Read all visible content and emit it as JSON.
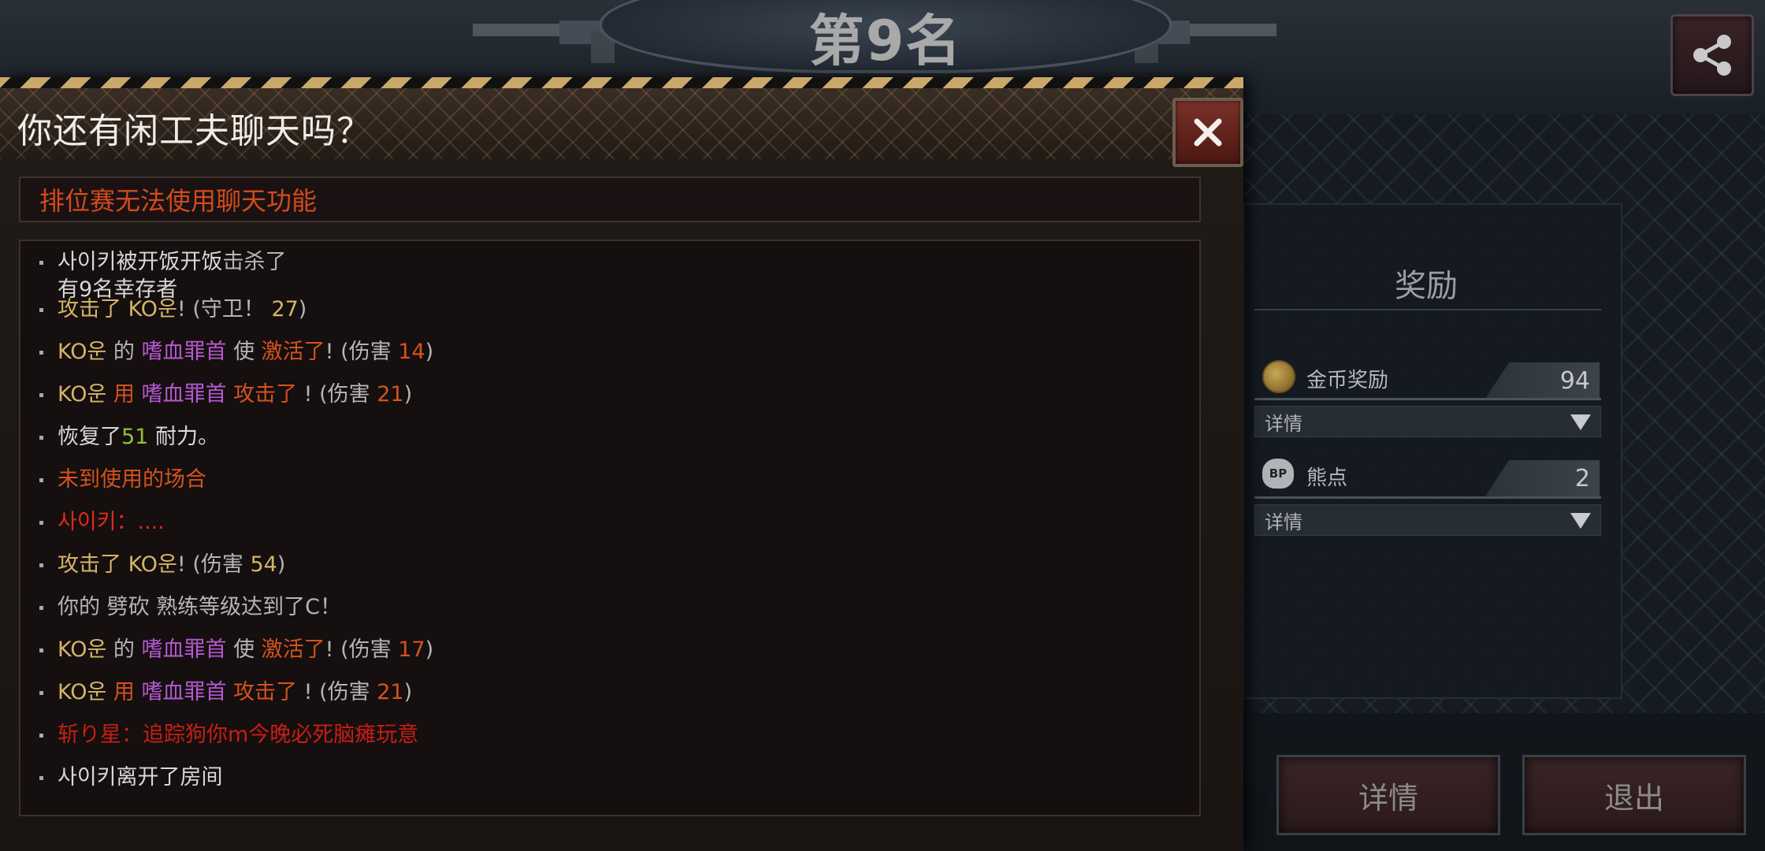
{
  "game": {
    "rank_title": "第9名"
  },
  "chat_modal": {
    "title": "你还有闲工夫聊天吗？",
    "notice": "排位赛无法使用聊天功能",
    "lines": [
      {
        "parts": [
          {
            "t": "사이키",
            "c": "white"
          },
          {
            "t": "被开饭开饭",
            "c": "white"
          },
          {
            "t": "击杀了",
            "c": "gray"
          }
        ],
        "second": "有9名幸存者"
      },
      {
        "parts": [
          {
            "t": "攻击了 KO운",
            "c": "gold"
          },
          {
            "t": "! (守卫！ ",
            "c": "gray"
          },
          {
            "t": "27",
            "c": "gold"
          },
          {
            "t": ")",
            "c": "gray"
          }
        ]
      },
      {
        "parts": [
          {
            "t": "KO운",
            "c": "gold"
          },
          {
            "t": " 的 ",
            "c": "gray"
          },
          {
            "t": "嗜血罪首",
            "c": "purple"
          },
          {
            "t": " 使 ",
            "c": "gray"
          },
          {
            "t": " 激活了",
            "c": "orange"
          },
          {
            "t": "! (伤害 ",
            "c": "gray"
          },
          {
            "t": "14",
            "c": "orange"
          },
          {
            "t": ")",
            "c": "gray"
          }
        ]
      },
      {
        "parts": [
          {
            "t": "KO운",
            "c": "gold"
          },
          {
            "t": "  用 ",
            "c": "orange"
          },
          {
            "t": "嗜血罪首",
            "c": "purple"
          },
          {
            "t": " 攻击了 ",
            "c": "orange"
          },
          {
            "t": " ! (伤害 ",
            "c": "gray"
          },
          {
            "t": "21",
            "c": "orange"
          },
          {
            "t": ")",
            "c": "gray"
          }
        ]
      },
      {
        "parts": [
          {
            "t": "恢复了",
            "c": "white"
          },
          {
            "t": "51",
            "c": "green"
          },
          {
            "t": " 耐力。",
            "c": "white"
          }
        ]
      },
      {
        "parts": [
          {
            "t": "未到使用的场合",
            "c": "orange"
          }
        ]
      },
      {
        "parts": [
          {
            "t": "사이키：....",
            "c": "red"
          }
        ]
      },
      {
        "parts": [
          {
            "t": "攻击了 KO운",
            "c": "gold"
          },
          {
            "t": "! (伤害 ",
            "c": "gray"
          },
          {
            "t": "54",
            "c": "gold"
          },
          {
            "t": ")",
            "c": "gray"
          }
        ]
      },
      {
        "parts": [
          {
            "t": "你的 劈砍 熟练等级达到了C！",
            "c": "gray"
          }
        ]
      },
      {
        "parts": [
          {
            "t": "KO운",
            "c": "gold"
          },
          {
            "t": " 的 ",
            "c": "gray"
          },
          {
            "t": "嗜血罪首",
            "c": "purple"
          },
          {
            "t": " 使 ",
            "c": "gray"
          },
          {
            "t": " 激活了",
            "c": "orange"
          },
          {
            "t": "! (伤害 ",
            "c": "gray"
          },
          {
            "t": "17",
            "c": "orange"
          },
          {
            "t": ")",
            "c": "gray"
          }
        ]
      },
      {
        "parts": [
          {
            "t": "KO운",
            "c": "gold"
          },
          {
            "t": "  用 ",
            "c": "orange"
          },
          {
            "t": "嗜血罪首",
            "c": "purple"
          },
          {
            "t": " 攻击了 ",
            "c": "orange"
          },
          {
            "t": " ! (伤害 ",
            "c": "gray"
          },
          {
            "t": "21",
            "c": "orange"
          },
          {
            "t": ")",
            "c": "gray"
          }
        ]
      },
      {
        "parts": [
          {
            "t": "斩り星：追踪狗你m今晚必死脑瘫玩意",
            "c": "darkred"
          }
        ]
      },
      {
        "parts": [
          {
            "t": "사이키离开了房间",
            "c": "white"
          }
        ]
      }
    ]
  },
  "reward_panel": {
    "title": "奖励",
    "coin": {
      "label": "金币奖励",
      "value": "94",
      "icon": "coin-icon"
    },
    "bear_points": {
      "label": "熊点",
      "value": "2",
      "icon": "bear-points-icon",
      "icon_text": "BP"
    },
    "detail_label": "详情"
  },
  "buttons": {
    "details": "详情",
    "exit": "退出"
  },
  "colors": {
    "white": "#d8d8d8",
    "gray": "#b5b5b5",
    "gold": "#d4b468",
    "purple": "#b558d0",
    "orange": "#d4521e",
    "green": "#8fc23a",
    "red": "#e02a1a",
    "darkred": "#c81e14"
  }
}
